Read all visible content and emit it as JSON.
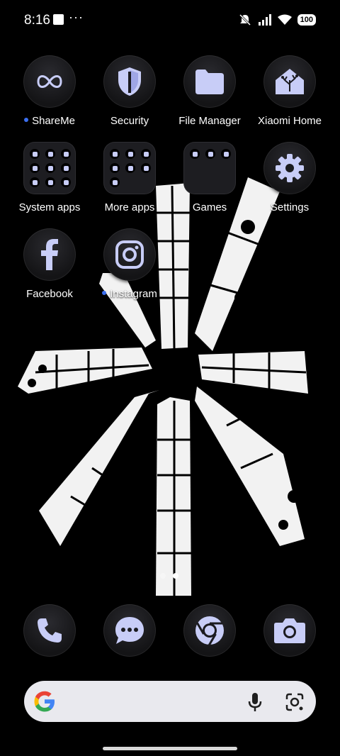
{
  "status": {
    "time": "8:16",
    "overflow": "···",
    "battery": "100"
  },
  "apps": [
    {
      "label": "ShareMe",
      "badge": true,
      "icon": "shareme-icon"
    },
    {
      "label": "Security",
      "icon": "shield-icon"
    },
    {
      "label": "File Manager",
      "icon": "folder-icon"
    },
    {
      "label": "Xiaomi Home",
      "icon": "home-tree-icon"
    },
    {
      "label": "System apps",
      "icon": "folder-grid-icon"
    },
    {
      "label": "More apps",
      "icon": "folder-grid-icon"
    },
    {
      "label": "Games",
      "icon": "folder-grid-icon"
    },
    {
      "label": "Settings",
      "icon": "gear-icon"
    },
    {
      "label": "Facebook",
      "icon": "facebook-icon"
    },
    {
      "label": "Instagram",
      "badge": true,
      "icon": "instagram-icon"
    }
  ],
  "dock": [
    {
      "name": "phone-icon"
    },
    {
      "name": "messages-icon"
    },
    {
      "name": "chrome-icon"
    },
    {
      "name": "camera-icon"
    }
  ],
  "pager": {
    "pages": 2,
    "current": 2
  },
  "search": {
    "icons": [
      "google-g-icon",
      "microphone-icon",
      "google-lens-icon"
    ]
  },
  "colors": {
    "accent": "#c8cdf7",
    "badge": "#3b6ff0",
    "search_bg": "#e9e9ee"
  }
}
